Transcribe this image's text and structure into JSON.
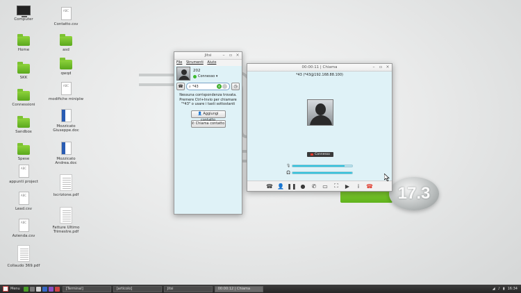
{
  "desktop": {
    "icons_col1": [
      {
        "label": "Computer",
        "icon": "monitor-icon"
      },
      {
        "label": "Home",
        "icon": "home-folder-icon"
      },
      {
        "label": "SKK",
        "icon": "folder-icon"
      },
      {
        "label": "Connessioni",
        "icon": "folder-icon"
      },
      {
        "label": "Sandbox",
        "icon": "folder-icon"
      },
      {
        "label": "Spese",
        "icon": "folder-icon"
      },
      {
        "label": "appunti project",
        "icon": "doc-icon"
      },
      {
        "label": "Lead.csv",
        "icon": "doc-icon"
      },
      {
        "label": "Azienda.csv",
        "icon": "doc-icon"
      },
      {
        "label": "Collaudo 369.pdf",
        "icon": "pdf-icon"
      }
    ],
    "icons_col2": [
      {
        "label": "Contatto.csv",
        "icon": "doc-icon"
      },
      {
        "label": "asd",
        "icon": "folder-icon"
      },
      {
        "label": "qwqd",
        "icon": "folder-icon"
      },
      {
        "label": "modifiche miniplw",
        "icon": "doc-icon"
      },
      {
        "label": "Mozzicato Giuseppe.doc",
        "icon": "word-doc-icon"
      },
      {
        "label": "Mozzicato Andrea.doc",
        "icon": "word-doc-icon"
      },
      {
        "label": "Iscrizione.pdf",
        "icon": "pdf-icon"
      },
      {
        "label": "Fatture Ultimo Trimestre.pdf",
        "icon": "pdf-icon"
      }
    ],
    "badge_text": "17.3"
  },
  "jitsi": {
    "title": "Jitsi",
    "menu": [
      "File",
      "Strumenti",
      "Aiuto"
    ],
    "account": {
      "name": "202",
      "status": "Connesso"
    },
    "search": {
      "value": "*43"
    },
    "hint": "Nessuna corrispondenza trovata. Premere Ctrl+Invio per chiamare \"*43\" o usare i tasti sottostanti",
    "add_contact": "Aggiungi contatto",
    "call_contact": "Chiama contatto"
  },
  "call": {
    "title": "00:00:11 | Chiama",
    "peer": "*43 (*43@192.168.88.100)",
    "status": "Connesso",
    "mic_level": 0.87,
    "speaker_level": 1.0
  },
  "taskbar": {
    "menu_label": "Menu",
    "tasks": [
      "[Terminal]",
      "[articolo]",
      "Jitsi",
      "00:00:12 | Chiama"
    ],
    "active_task": 3,
    "clock": "16:34"
  }
}
